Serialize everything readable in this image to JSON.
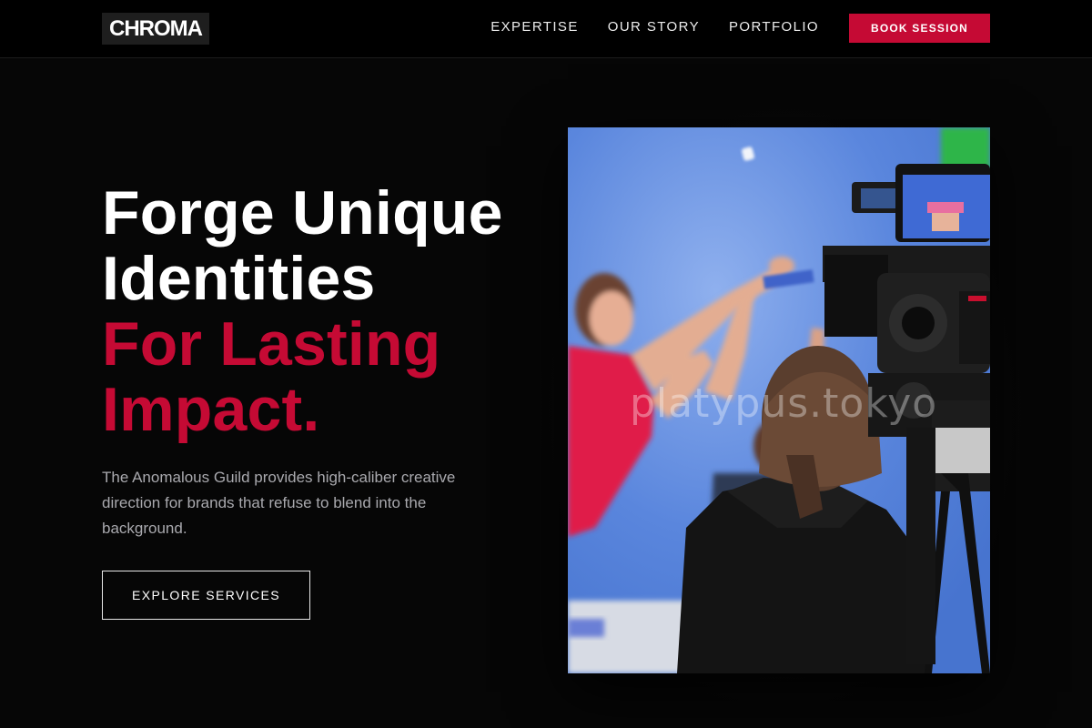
{
  "header": {
    "logo": "CHROMA",
    "nav": [
      {
        "label": "EXPERTISE"
      },
      {
        "label": "OUR STORY"
      },
      {
        "label": "PORTFOLIO"
      }
    ],
    "cta_label": "BOOK SESSION"
  },
  "hero": {
    "title_lines": [
      "Forge Unique",
      "Identities"
    ],
    "accent_lines": [
      "For Lasting",
      "Impact."
    ],
    "description": "The Anomalous Guild provides high-caliber creative direction for brands that refuse to blend into the background.",
    "button_label": "EXPLORE SERVICES",
    "image_watermark": "platypus.tokyo"
  },
  "colors": {
    "accent": "#c50a34",
    "background": "#060606",
    "header_background": "#000000",
    "body_text": "#a9a9ae"
  }
}
